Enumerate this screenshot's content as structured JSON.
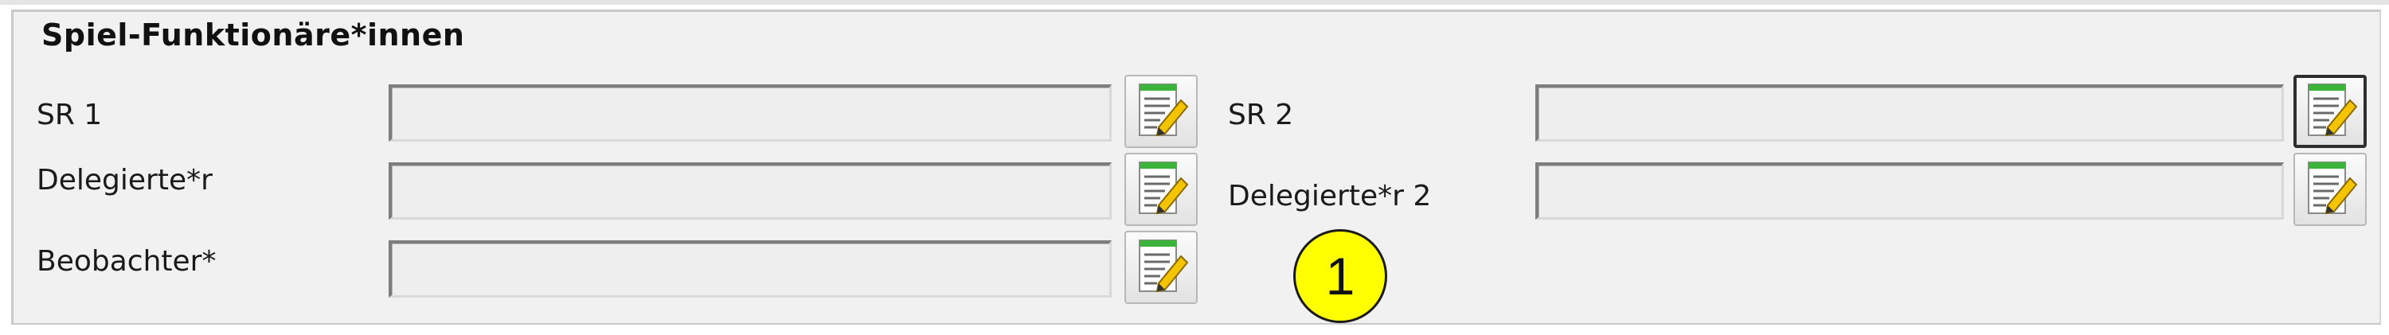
{
  "group": {
    "legend": "Spiel-Funktionäre*innen"
  },
  "fields": {
    "sr1": {
      "label": "SR 1",
      "value": ""
    },
    "sr2": {
      "label": "SR 2",
      "value": ""
    },
    "delegate1": {
      "label": "Delegierte*r",
      "value": ""
    },
    "delegate2": {
      "label": "Delegierte*r 2",
      "value": ""
    },
    "observer": {
      "label": "Beobachter*",
      "value": ""
    }
  },
  "annotation": {
    "marker_number": "1",
    "marker_color": "#ffff00"
  },
  "icons": {
    "edit_button": "edit-list-icon"
  },
  "colors": {
    "panel_background": "#f1f1f1",
    "field_background": "#eeeeee",
    "icon_accent_green": "#3cb43c",
    "icon_pencil_yellow": "#f5c400"
  }
}
